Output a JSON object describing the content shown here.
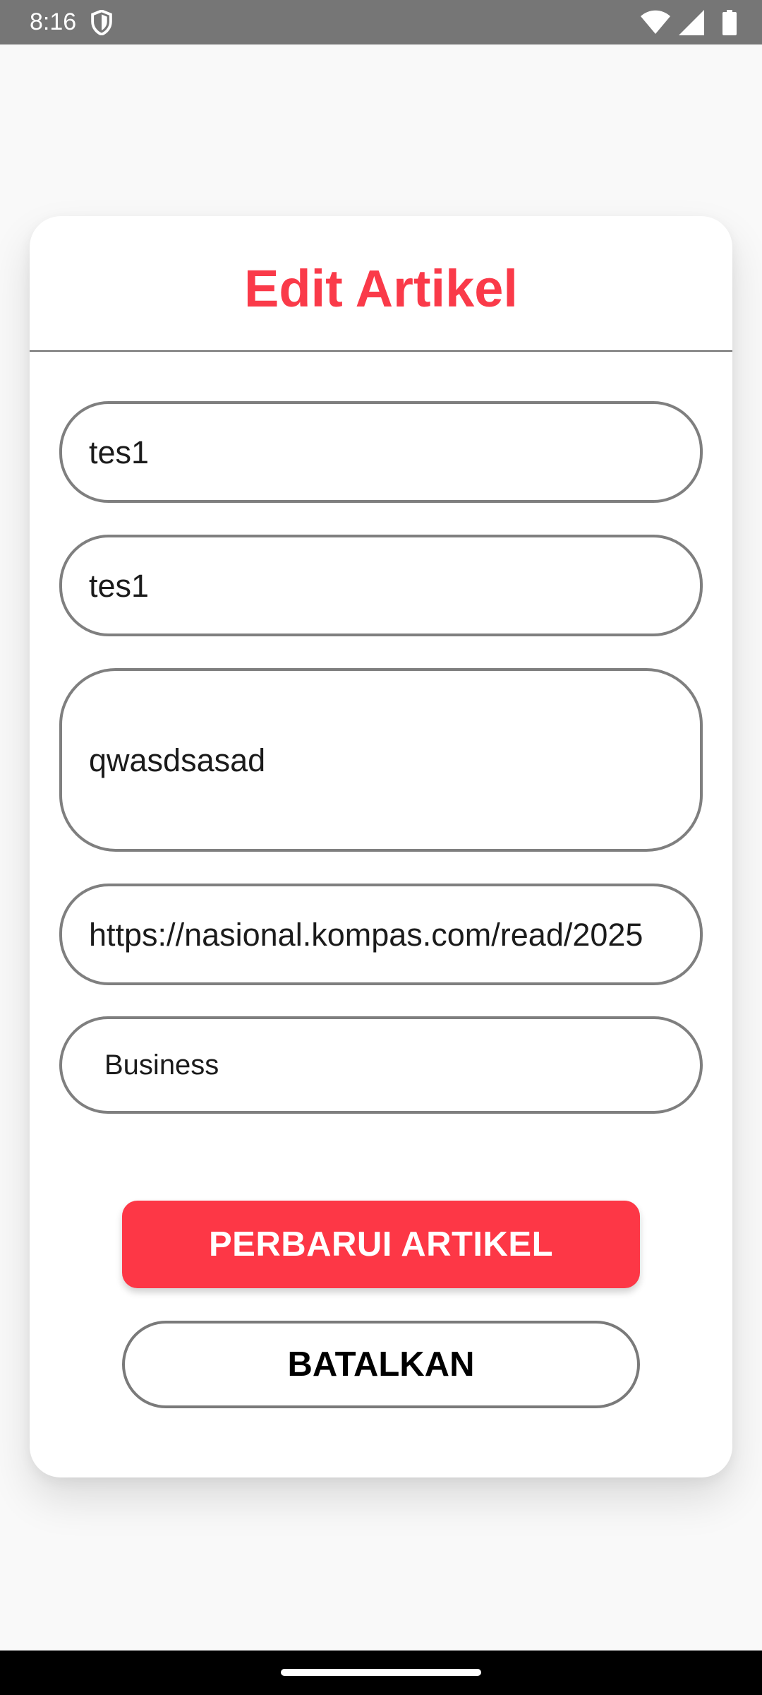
{
  "status_bar": {
    "time": "8:16",
    "icons": [
      "shield-icon",
      "wifi-icon",
      "signal-icon",
      "battery-icon"
    ]
  },
  "dialog": {
    "title": "Edit Artikel",
    "fields": [
      {
        "name": "title-field",
        "value": "tes1"
      },
      {
        "name": "author-field",
        "value": "tes1"
      },
      {
        "name": "content-field",
        "value": "qwasdsasad"
      },
      {
        "name": "url-field",
        "value": "https://nasional.kompas.com/read/2025"
      },
      {
        "name": "category-select",
        "value": "Business"
      }
    ],
    "update_button": "PERBARUI ARTIKEL",
    "cancel_button": "BATALKAN"
  },
  "colors": {
    "accent": "#fa3a49",
    "button": "#fd3746",
    "status_bar": "#767676",
    "background": "#f9f9f9"
  }
}
